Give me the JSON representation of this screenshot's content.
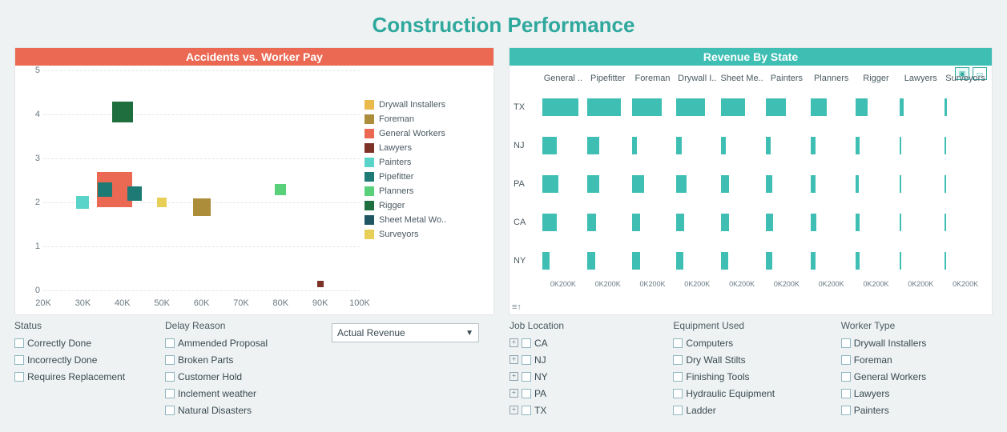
{
  "title": "Construction Performance",
  "left_panel": {
    "title": "Accidents vs. Worker Pay"
  },
  "right_panel": {
    "title": "Revenue By State"
  },
  "chart_data": [
    {
      "type": "scatter",
      "title": "Accidents vs. Worker Pay",
      "xlabel": "",
      "ylabel": "",
      "xlim": [
        20000,
        100000
      ],
      "ylim": [
        0,
        5
      ],
      "xticks_display": [
        "20K",
        "30K",
        "40K",
        "50K",
        "60K",
        "70K",
        "80K",
        "90K",
        "100K"
      ],
      "yticks_display": [
        "0",
        "1",
        "2",
        "3",
        "4",
        "5"
      ],
      "series": [
        {
          "name": "Drywall Installers",
          "color": "#e9b94b",
          "points": [
            {
              "x": 40000,
              "y": 2.4,
              "size": 18
            }
          ]
        },
        {
          "name": "Foreman",
          "color": "#ab8d3a",
          "points": [
            {
              "x": 60000,
              "y": 1.9,
              "size": 22
            }
          ]
        },
        {
          "name": "General Workers",
          "color": "#eb6852",
          "points": [
            {
              "x": 38000,
              "y": 2.3,
              "size": 44
            }
          ]
        },
        {
          "name": "Lawyers",
          "color": "#7d3228",
          "points": [
            {
              "x": 90000,
              "y": 0.15,
              "size": 8
            }
          ]
        },
        {
          "name": "Painters",
          "color": "#5ad4c9",
          "points": [
            {
              "x": 30000,
              "y": 2.0,
              "size": 16
            }
          ]
        },
        {
          "name": "Pipefitter",
          "color": "#1d7a74",
          "points": [
            {
              "x": 35500,
              "y": 2.3,
              "size": 18
            },
            {
              "x": 43000,
              "y": 2.2,
              "size": 18
            }
          ]
        },
        {
          "name": "Planners",
          "color": "#59d07a",
          "points": [
            {
              "x": 80000,
              "y": 2.3,
              "size": 14
            }
          ]
        },
        {
          "name": "Rigger",
          "color": "#1f6e3d",
          "points": [
            {
              "x": 40000,
              "y": 4.05,
              "size": 26
            }
          ]
        },
        {
          "name": "Sheet Metal Wo..",
          "color": "#1f5662",
          "points": []
        },
        {
          "name": "Surveyors",
          "color": "#e7cf58",
          "points": [
            {
              "x": 50000,
              "y": 2.0,
              "size": 12
            }
          ]
        }
      ]
    },
    {
      "type": "bar",
      "title": "Revenue By State",
      "orientation": "small-multiples-horizontal",
      "columns": [
        "General ..",
        "Pipefitter",
        "Foreman",
        "Drywall I..",
        "Sheet Me..",
        "Painters",
        "Planners",
        "Rigger",
        "Lawyers",
        "Surveyors"
      ],
      "categories": [
        "TX",
        "NJ",
        "PA",
        "CA",
        "NY"
      ],
      "xlim": [
        0,
        200000
      ],
      "xticks_display": "0K200K",
      "values": {
        "TX": [
          180000,
          170000,
          150000,
          140000,
          120000,
          100000,
          80000,
          60000,
          20000,
          10000
        ],
        "NJ": [
          70000,
          60000,
          25000,
          25000,
          25000,
          25000,
          25000,
          20000,
          8000,
          8000
        ],
        "PA": [
          80000,
          60000,
          60000,
          50000,
          40000,
          30000,
          25000,
          18000,
          8000,
          8000
        ],
        "CA": [
          70000,
          45000,
          40000,
          40000,
          40000,
          35000,
          30000,
          20000,
          8000,
          8000
        ],
        "NY": [
          35000,
          40000,
          40000,
          35000,
          35000,
          30000,
          25000,
          20000,
          8000,
          8000
        ]
      },
      "bar_color": "#3fbfb4"
    }
  ],
  "legend_items": [
    {
      "label": "Drywall Installers",
      "color": "#e9b94b"
    },
    {
      "label": "Foreman",
      "color": "#ab8d3a"
    },
    {
      "label": "General Workers",
      "color": "#eb6852"
    },
    {
      "label": "Lawyers",
      "color": "#7d3228"
    },
    {
      "label": "Painters",
      "color": "#5ad4c9"
    },
    {
      "label": "Pipefitter",
      "color": "#1d7a74"
    },
    {
      "label": "Planners",
      "color": "#59d07a"
    },
    {
      "label": "Rigger",
      "color": "#1f6e3d"
    },
    {
      "label": "Sheet Metal Wo..",
      "color": "#1f5662"
    },
    {
      "label": "Surveyors",
      "color": "#e7cf58"
    }
  ],
  "dropdown": {
    "selected": "Actual Revenue"
  },
  "filters": {
    "status": {
      "title": "Status",
      "items": [
        "Correctly Done",
        "Incorrectly Done",
        "Requires Replacement"
      ]
    },
    "delay": {
      "title": "Delay Reason",
      "items": [
        "Ammended Proposal",
        "Broken Parts",
        "Customer Hold",
        "Inclement weather",
        "Natural Disasters"
      ]
    },
    "jobloc": {
      "title": "Job Location",
      "items": [
        "CA",
        "NJ",
        "NY",
        "PA",
        "TX"
      ]
    },
    "equip": {
      "title": "Equipment Used",
      "items": [
        "Computers",
        "Dry Wall Stilts",
        "Finishing Tools",
        "Hydraulic Equipment",
        "Ladder"
      ]
    },
    "wtype": {
      "title": "Worker Type",
      "items": [
        "Drywall Installers",
        "Foreman",
        "General Workers",
        "Lawyers",
        "Painters"
      ]
    }
  }
}
